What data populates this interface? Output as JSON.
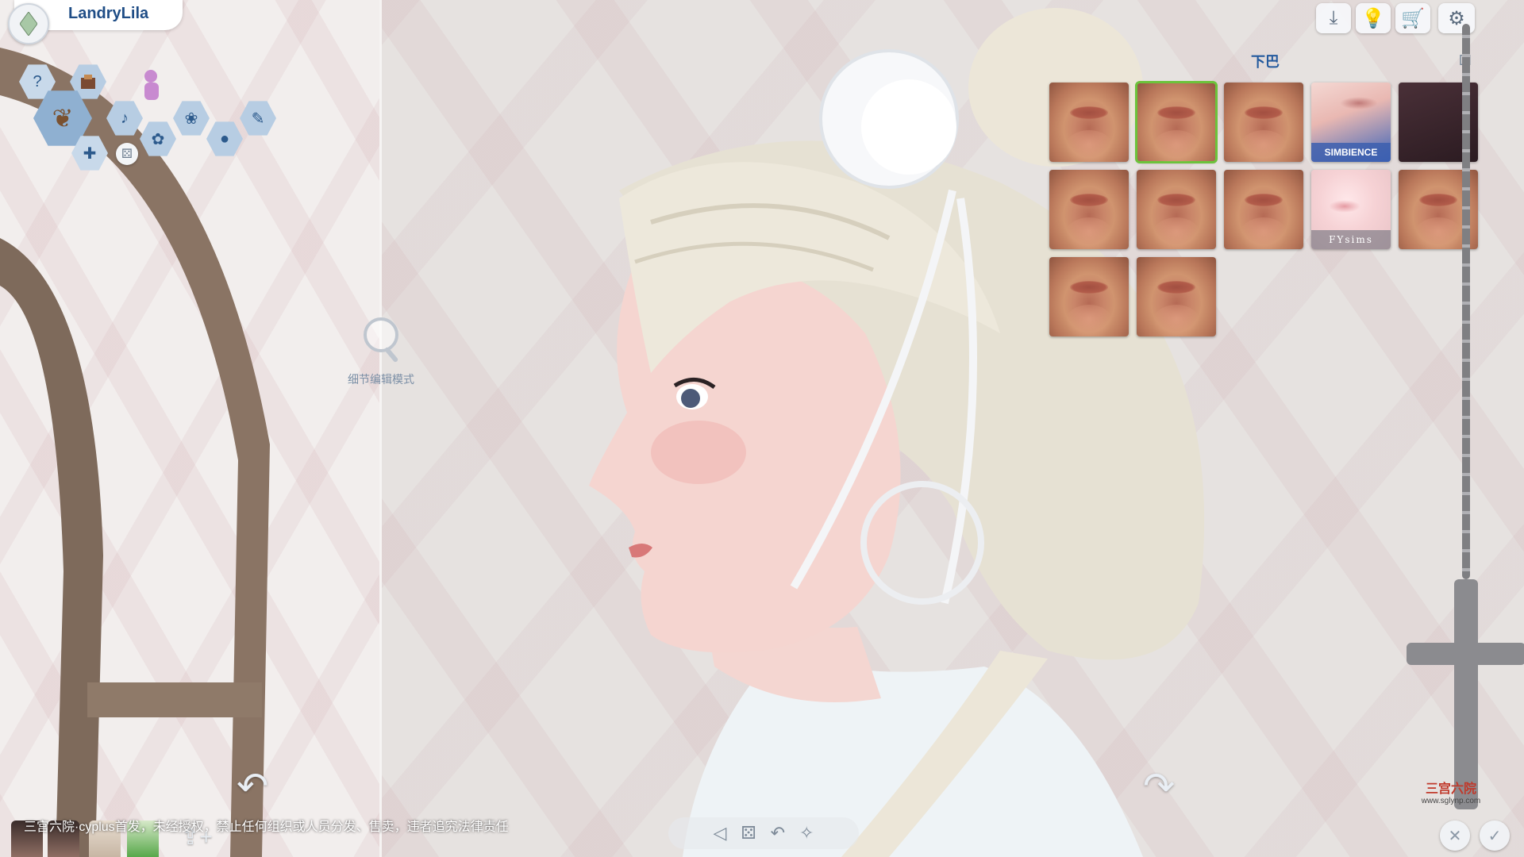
{
  "header": {
    "sim_name": "LandryLila"
  },
  "icons": {
    "help": "?",
    "dice": "⚄",
    "aspiration": "❦"
  },
  "toolbar": {
    "buttons": [
      {
        "name": "gallery-icon",
        "glyph": "⤓"
      },
      {
        "name": "tips-icon",
        "glyph": "💡"
      },
      {
        "name": "shop-icon",
        "glyph": "🛒"
      },
      {
        "name": "options-icon",
        "glyph": "⚙"
      }
    ]
  },
  "detail_edit": {
    "label": "细节编辑模式"
  },
  "cas_panel": {
    "title": "下巴",
    "swatches": [
      {
        "kind": "skin",
        "selected": false,
        "caption": ""
      },
      {
        "kind": "skin",
        "selected": true,
        "caption": ""
      },
      {
        "kind": "skin",
        "selected": false,
        "caption": ""
      },
      {
        "kind": "simbience",
        "selected": false,
        "caption": "SIMBIENCE"
      },
      {
        "kind": "dark",
        "selected": false,
        "caption": ""
      },
      {
        "kind": "skin",
        "selected": false,
        "caption": ""
      },
      {
        "kind": "skin",
        "selected": false,
        "caption": ""
      },
      {
        "kind": "skin",
        "selected": false,
        "caption": ""
      },
      {
        "kind": "fysims",
        "selected": false,
        "caption": "FYsims"
      },
      {
        "kind": "skin",
        "selected": false,
        "caption": ""
      },
      {
        "kind": "skin",
        "selected": false,
        "caption": ""
      },
      {
        "kind": "skin",
        "selected": false,
        "caption": ""
      }
    ]
  },
  "bottom": {
    "watermark_text": "三宫六院·cyplus首发，未经授权，禁止任何组织或人员分发、售卖，违者追究法律责任",
    "rotate_left": "↶",
    "rotate_right": "↷",
    "center_controls": [
      "◁",
      "⚄",
      "↶",
      "✧"
    ],
    "add_sim": "⇪+",
    "cancel": "✕",
    "confirm": "✓"
  },
  "logo": {
    "text": "三宫六院",
    "url": "www.sglynp.com"
  }
}
